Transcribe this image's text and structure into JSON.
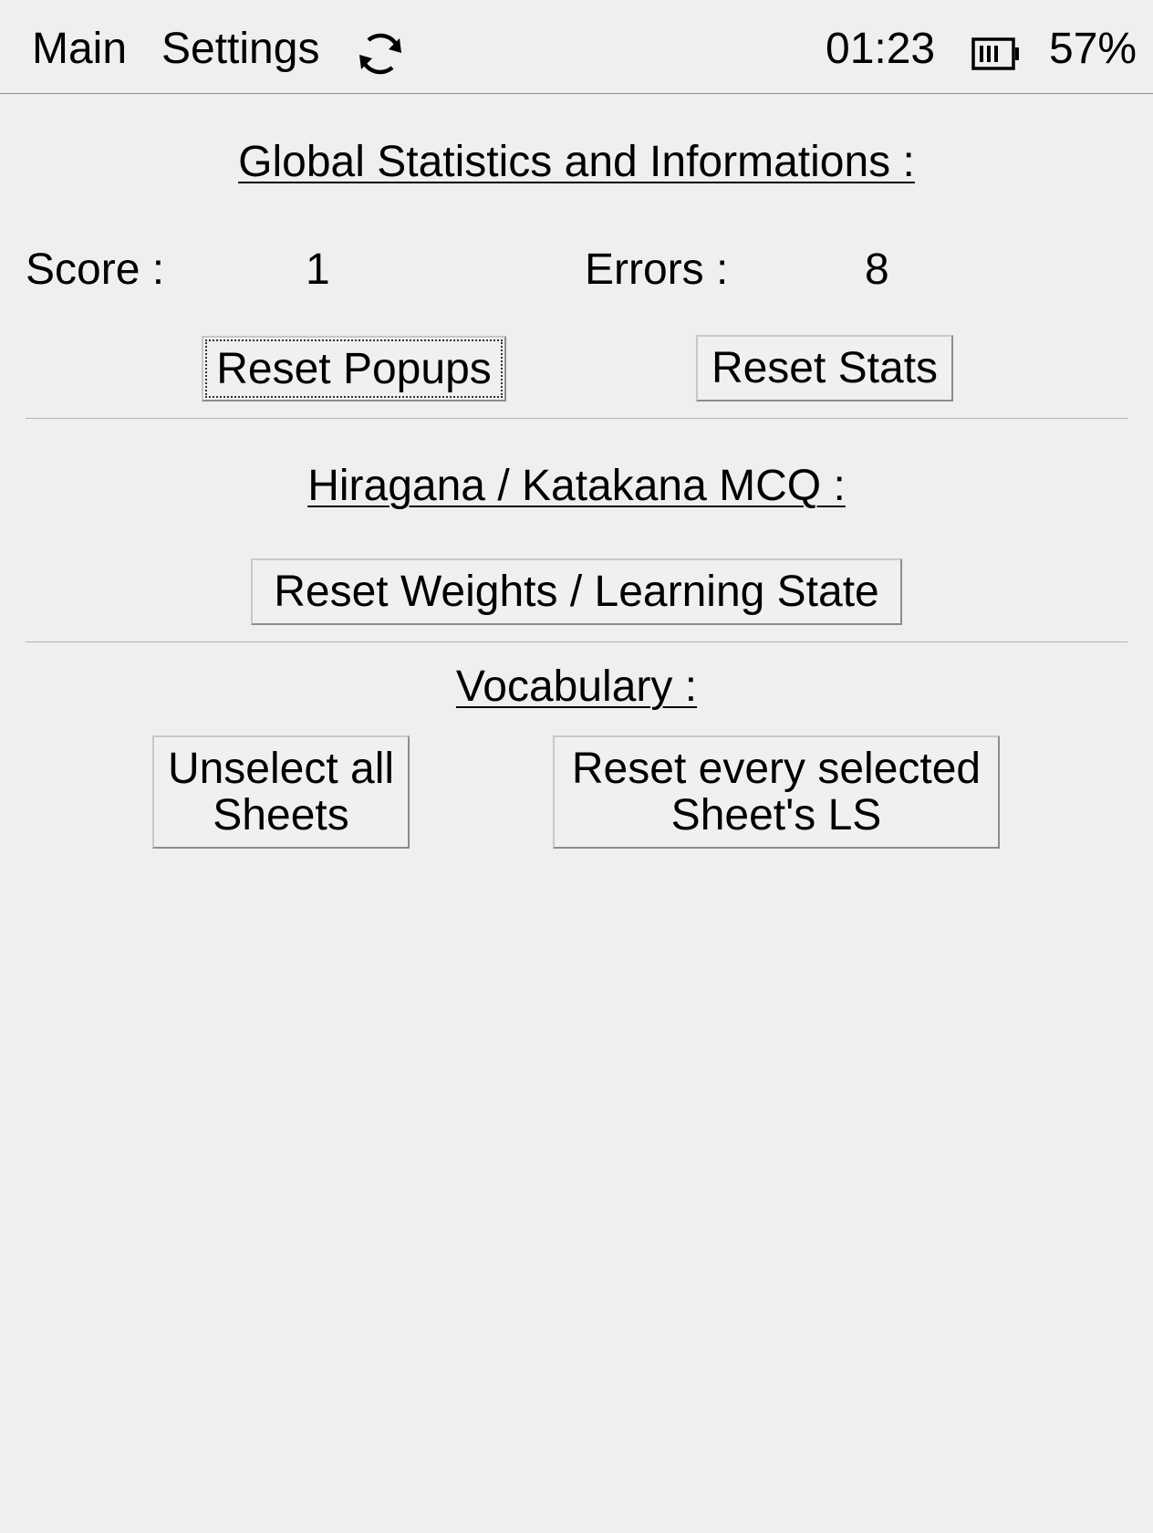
{
  "topbar": {
    "main_label": "Main",
    "settings_label": "Settings",
    "refresh_icon": "refresh-icon",
    "clock": "01:23",
    "battery_icon": "battery-icon",
    "battery_percent": "57%"
  },
  "global_stats": {
    "heading": "Global Statistics and Informations :",
    "score_label": "Score :",
    "score_value": "1",
    "errors_label": "Errors :",
    "errors_value": "8",
    "reset_popups_label": "Reset Popups",
    "reset_stats_label": "Reset Stats"
  },
  "kana_mcq": {
    "heading": "Hiragana / Katakana MCQ :",
    "reset_weights_label": "Reset Weights / Learning State"
  },
  "vocabulary": {
    "heading": "Vocabulary :",
    "unselect_line1": "Unselect all",
    "unselect_line2": "Sheets",
    "reset_sheets_line1": "Reset every selected",
    "reset_sheets_line2": "Sheet's LS"
  }
}
